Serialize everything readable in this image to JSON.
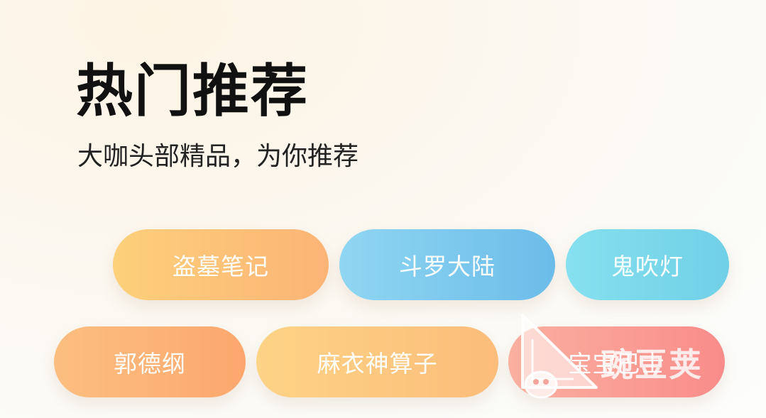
{
  "header": {
    "title": "热门推荐",
    "subtitle": "大咖头部精品，为你推荐"
  },
  "tags": [
    {
      "label": "盗墓笔记"
    },
    {
      "label": "斗罗大陆"
    },
    {
      "label": "鬼吹灯"
    },
    {
      "label": "郭德纲"
    },
    {
      "label": "麻衣神算子"
    },
    {
      "label": "宝宝巴士"
    }
  ],
  "watermark": {
    "text": "豌豆荚",
    "icon": "pea-pod-logo-icon"
  },
  "colors": {
    "title": "#111111",
    "tag_orange": "#fcb476",
    "tag_blue": "#6cbcea",
    "tag_cyan": "#70d0e6",
    "tag_peach": "#fca76d",
    "tag_yellow": "#fcbd7a",
    "tag_pink": "#f98c8a"
  }
}
